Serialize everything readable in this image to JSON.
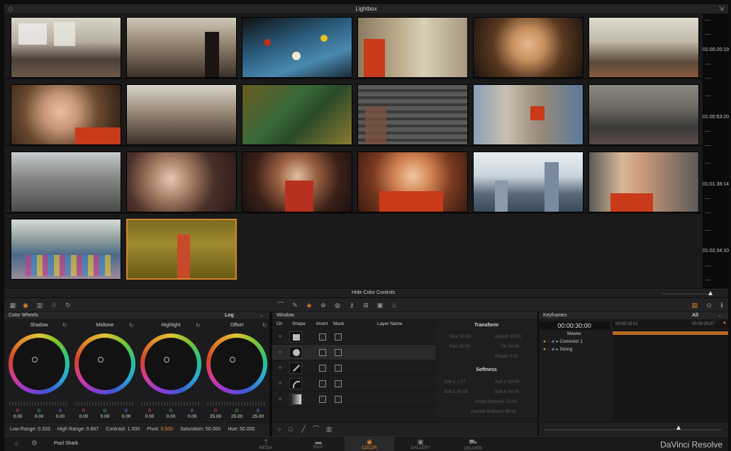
{
  "window": {
    "title": "Lightbox"
  },
  "timecodes": [
    "01:00:20:19",
    "01:00:53:20",
    "01:01:38:14",
    "01:02:34:10"
  ],
  "lower_bar": {
    "label": "Hide Color Controls"
  },
  "color_wheels": {
    "title": "Color Wheels",
    "mode": "Log",
    "wheels": [
      {
        "label": "Shadow",
        "values": [
          "0.00",
          "0.00",
          "0.00"
        ]
      },
      {
        "label": "Midtone",
        "values": [
          "0.00",
          "0.00",
          "0.00"
        ]
      },
      {
        "label": "Highlight",
        "values": [
          "0.00",
          "0.00",
          "0.00"
        ]
      },
      {
        "label": "Offset",
        "values": [
          "25.00",
          "25.00",
          "25.00"
        ]
      }
    ],
    "channel_labels": [
      "R",
      "G",
      "B"
    ],
    "footer": {
      "low_range": "Low Range: 0.333",
      "high_range": "High Range: 0.667",
      "contrast": "Contrast: 1.000",
      "pivot_label": "Pivot:",
      "pivot_value": "0.500",
      "saturation": "Saturation: 50.000",
      "hue": "Hue: 50.000"
    }
  },
  "window_panel": {
    "title": "Window",
    "columns": [
      "On",
      "Shape",
      "Invert",
      "Mask",
      "Layer Name"
    ],
    "transform_title": "Transform",
    "transform_lines": [
      "Size: 50.00",
      "Aspect: 50.00",
      "Pan: 50.00",
      "Tilt: 50.00",
      "Rotate: 0.00"
    ],
    "softness_title": "Softness",
    "softness_lines": [
      "Soft 1: 2.07",
      "Soft 2: 50.00",
      "Soft 3: 50.00",
      "Soft 4: 50.00",
      "Inside Softness: 50.00",
      "Outside Softness: 50.00"
    ]
  },
  "keyframes": {
    "title": "Keyframes",
    "filter": "All",
    "current_time": "00:00:30:00",
    "ruler": [
      "00:00:15:01",
      "00:00:25:07"
    ],
    "tracks": [
      "Master",
      "Corrector 1",
      "Sizing"
    ]
  },
  "pagebar": {
    "project": "Pool Shark",
    "tabs": [
      "MEDIA",
      "EDIT",
      "COLOR",
      "GALLERY",
      "DELIVER"
    ],
    "brand": "DaVinci Resolve"
  }
}
